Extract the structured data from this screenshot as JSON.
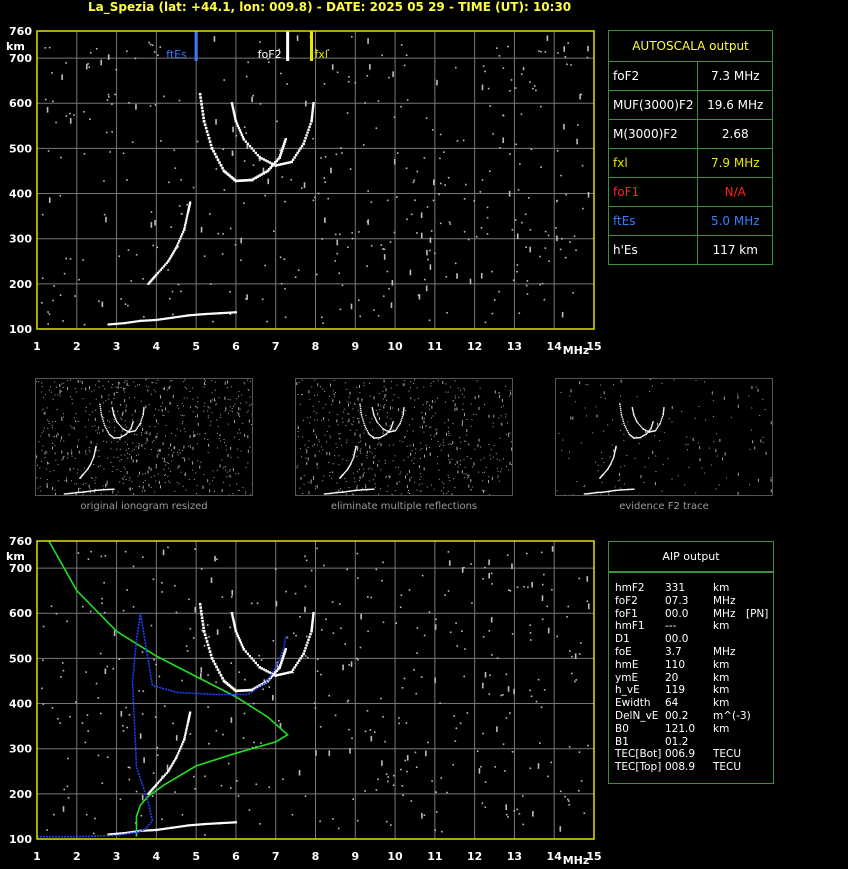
{
  "title": "La_Spezia (lat: +44.1, lon: 009.8) - DATE: 2025 05 29 - TIME (UT): 10:30",
  "colors": {
    "axis": "#e0e000",
    "grid": "#777777",
    "green_box": "#3c8f3c",
    "ftes": "#3a7bff",
    "fof2": "#ffffff",
    "fxl": "#e8e800",
    "fof1": "#ff2020"
  },
  "chart_data": [
    {
      "type": "scatter",
      "title": "",
      "xlabel": "MHz",
      "ylabel": "km",
      "xlim": [
        1,
        15
      ],
      "ylim": [
        100,
        760
      ],
      "xticks": [
        1,
        2,
        3,
        4,
        5,
        6,
        7,
        8,
        9,
        10,
        11,
        12,
        13,
        14,
        15
      ],
      "yticks": [
        100,
        200,
        300,
        400,
        500,
        600,
        700,
        760
      ],
      "grid": true,
      "markers": [
        {
          "label": "ftEs",
          "x": 5.0,
          "color": "#3a7bff"
        },
        {
          "label": "foF2",
          "x": 7.3,
          "color": "#ffffff"
        },
        {
          "label": "fxl",
          "x": 7.9,
          "color": "#e8e800"
        }
      ],
      "traces": {
        "es_trace": [
          [
            2.8,
            110
          ],
          [
            3.2,
            113
          ],
          [
            3.6,
            118
          ],
          [
            4.0,
            120
          ],
          [
            4.4,
            125
          ],
          [
            4.8,
            130
          ],
          [
            5.2,
            133
          ],
          [
            5.6,
            135
          ],
          [
            6.0,
            137
          ]
        ],
        "f1_trace": [
          [
            3.8,
            200
          ],
          [
            4.0,
            220
          ],
          [
            4.3,
            250
          ],
          [
            4.5,
            280
          ],
          [
            4.7,
            320
          ],
          [
            4.8,
            360
          ],
          [
            4.85,
            380
          ]
        ],
        "o_trace": [
          [
            5.1,
            620
          ],
          [
            5.2,
            560
          ],
          [
            5.4,
            500
          ],
          [
            5.7,
            450
          ],
          [
            6.0,
            428
          ],
          [
            6.4,
            430
          ],
          [
            6.8,
            450
          ],
          [
            7.1,
            480
          ],
          [
            7.25,
            520
          ]
        ],
        "x_trace": [
          [
            5.9,
            600
          ],
          [
            6.0,
            560
          ],
          [
            6.2,
            520
          ],
          [
            6.6,
            480
          ],
          [
            7.0,
            462
          ],
          [
            7.4,
            470
          ],
          [
            7.7,
            510
          ],
          [
            7.9,
            560
          ],
          [
            7.95,
            600
          ]
        ]
      }
    },
    {
      "type": "line",
      "title": "",
      "xlabel": "MHz",
      "ylabel": "km",
      "xlim": [
        1,
        15
      ],
      "ylim": [
        100,
        760
      ],
      "xticks": [
        1,
        2,
        3,
        4,
        5,
        6,
        7,
        8,
        9,
        10,
        11,
        12,
        13,
        14,
        15
      ],
      "yticks": [
        100,
        200,
        300,
        400,
        500,
        600,
        700,
        760
      ],
      "grid": true,
      "series": [
        {
          "color": "#20e020",
          "points": [
            [
              1.3,
              760
            ],
            [
              2.0,
              650
            ],
            [
              3.0,
              560
            ],
            [
              4.0,
              505
            ],
            [
              5.0,
              460
            ],
            [
              6.0,
              415
            ],
            [
              6.8,
              370
            ],
            [
              7.3,
              331
            ],
            [
              7.0,
              315
            ],
            [
              6.0,
              290
            ],
            [
              5.0,
              262
            ],
            [
              4.2,
              220
            ],
            [
              3.8,
              195
            ],
            [
              3.6,
              175
            ],
            [
              3.5,
              150
            ],
            [
              3.5,
              105
            ]
          ]
        },
        {
          "color": "#2040ff",
          "points": [
            [
              1.0,
              105
            ],
            [
              2.0,
              105
            ],
            [
              3.0,
              108
            ],
            [
              3.5,
              115
            ],
            [
              3.7,
              120
            ],
            [
              3.9,
              140
            ],
            [
              3.8,
              180
            ],
            [
              3.5,
              260
            ],
            [
              3.4,
              450
            ],
            [
              3.5,
              540
            ],
            [
              3.6,
              600
            ],
            [
              3.9,
              440
            ],
            [
              4.5,
              425
            ],
            [
              5.5,
              420
            ],
            [
              6.3,
              420
            ],
            [
              6.8,
              450
            ],
            [
              7.0,
              480
            ],
            [
              7.2,
              520
            ],
            [
              7.25,
              550
            ]
          ]
        }
      ],
      "traces": {
        "es_trace": [
          [
            2.8,
            110
          ],
          [
            3.2,
            113
          ],
          [
            3.6,
            118
          ],
          [
            4.0,
            120
          ],
          [
            4.4,
            125
          ],
          [
            4.8,
            130
          ],
          [
            5.2,
            133
          ],
          [
            5.6,
            135
          ],
          [
            6.0,
            137
          ]
        ],
        "f1_trace": [
          [
            3.8,
            200
          ],
          [
            4.0,
            220
          ],
          [
            4.3,
            250
          ],
          [
            4.5,
            280
          ],
          [
            4.7,
            320
          ],
          [
            4.8,
            360
          ],
          [
            4.85,
            380
          ]
        ],
        "o_trace": [
          [
            5.1,
            620
          ],
          [
            5.2,
            560
          ],
          [
            5.4,
            500
          ],
          [
            5.7,
            450
          ],
          [
            6.0,
            428
          ],
          [
            6.4,
            430
          ],
          [
            6.8,
            450
          ],
          [
            7.1,
            480
          ],
          [
            7.25,
            520
          ]
        ],
        "x_trace": [
          [
            5.9,
            600
          ],
          [
            6.0,
            560
          ],
          [
            6.2,
            520
          ],
          [
            6.6,
            480
          ],
          [
            7.0,
            462
          ],
          [
            7.4,
            470
          ],
          [
            7.7,
            510
          ],
          [
            7.9,
            560
          ],
          [
            7.95,
            600
          ]
        ]
      }
    }
  ],
  "autoscala": {
    "header": "AUTOSCALA output",
    "rows": [
      {
        "label": "foF2",
        "value": "7.3 MHz",
        "color": "#ffffff"
      },
      {
        "label": "MUF(3000)F2",
        "value": "19.6 MHz",
        "color": "#ffffff"
      },
      {
        "label": "M(3000)F2",
        "value": "2.68",
        "color": "#ffffff"
      },
      {
        "label": "fxl",
        "value": "7.9 MHz",
        "color": "#e8e800"
      },
      {
        "label": "foF1",
        "value": "N/A",
        "color": "#ff2020"
      },
      {
        "label": "ftEs",
        "value": "5.0 MHz",
        "color": "#3a7bff"
      },
      {
        "label": "h'Es",
        "value": "117     km",
        "color": "#ffffff"
      }
    ]
  },
  "thumbnails": {
    "captions": [
      "original ionogram resized",
      "eliminate multiple reflections",
      "evidence F2 trace"
    ]
  },
  "aip": {
    "header": "AIP output",
    "rows": [
      [
        "hmF2",
        "331",
        "km",
        ""
      ],
      [
        "foF2",
        "07.3",
        "MHz",
        ""
      ],
      [
        "foF1",
        "00.0",
        "MHz",
        "[PN]"
      ],
      [
        "hmF1",
        "---",
        "km",
        ""
      ],
      [
        "D1",
        "00.0",
        "",
        ""
      ],
      [
        "foE",
        "3.7",
        "MHz",
        ""
      ],
      [
        "hmE",
        "110",
        "km",
        ""
      ],
      [
        "ymE",
        "20",
        "km",
        ""
      ],
      [
        "h_vE",
        "119",
        "km",
        ""
      ],
      [
        "Ewidth",
        "64",
        "km",
        ""
      ],
      [
        "DelN_vE",
        "00.2",
        "m^(-3)",
        ""
      ],
      [
        "B0",
        "121.0",
        "km",
        ""
      ],
      [
        "B1",
        "01.2",
        "",
        ""
      ],
      [
        "TEC[Bot]",
        "006.9",
        "TECU",
        ""
      ],
      [
        "TEC[Top]",
        "008.9",
        "TECU",
        ""
      ]
    ]
  }
}
